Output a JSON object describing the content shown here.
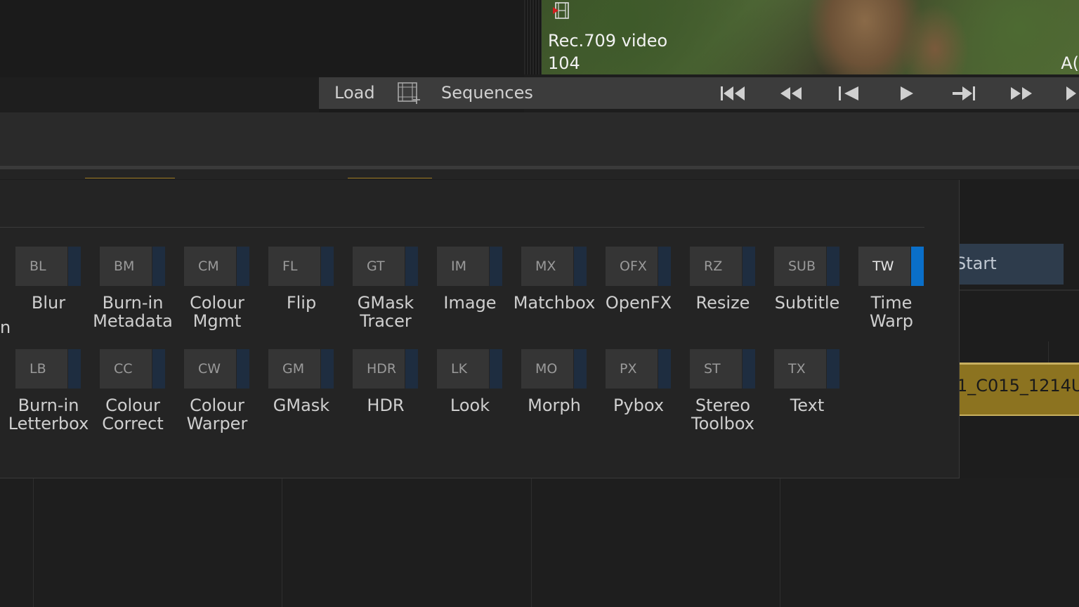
{
  "viewer": {
    "clip_colourspace": "Rec.709 video",
    "clip_frame": "104",
    "corner_text": "A("
  },
  "transport": {
    "load_label": "Load",
    "sequences_label": "Sequences",
    "buttons": [
      "first-frame",
      "rewind",
      "previous-frame",
      "play",
      "next-frame",
      "fast-forward",
      "last-frame"
    ]
  },
  "right_side": {
    "start_label": "Start",
    "clip_name": "1_C015_1214U"
  },
  "panel": {
    "cut_off_label": "n",
    "row1": [
      {
        "code": "BL",
        "label": "Blur"
      },
      {
        "code": "BM",
        "label": "Burn-in\nMetadata"
      },
      {
        "code": "CM",
        "label": "Colour\nMgmt"
      },
      {
        "code": "FL",
        "label": "Flip"
      },
      {
        "code": "GT",
        "label": "GMask\nTracer"
      },
      {
        "code": "IM",
        "label": "Image"
      },
      {
        "code": "MX",
        "label": "Matchbox"
      },
      {
        "code": "OFX",
        "label": "OpenFX"
      },
      {
        "code": "RZ",
        "label": "Resize"
      },
      {
        "code": "SUB",
        "label": "Subtitle"
      },
      {
        "code": "TW",
        "label": "Time\nWarp",
        "active": true
      }
    ],
    "row2": [
      {
        "code": "LB",
        "label": "Burn-in\nLetterbox"
      },
      {
        "code": "CC",
        "label": "Colour\nCorrect"
      },
      {
        "code": "CW",
        "label": "Colour\nWarper"
      },
      {
        "code": "GM",
        "label": "GMask"
      },
      {
        "code": "HDR",
        "label": "HDR"
      },
      {
        "code": "LK",
        "label": "Look"
      },
      {
        "code": "MO",
        "label": "Morph"
      },
      {
        "code": "PX",
        "label": "Pybox"
      },
      {
        "code": "ST",
        "label": "Stereo\nToolbox"
      },
      {
        "code": "TX",
        "label": "Text"
      }
    ]
  }
}
